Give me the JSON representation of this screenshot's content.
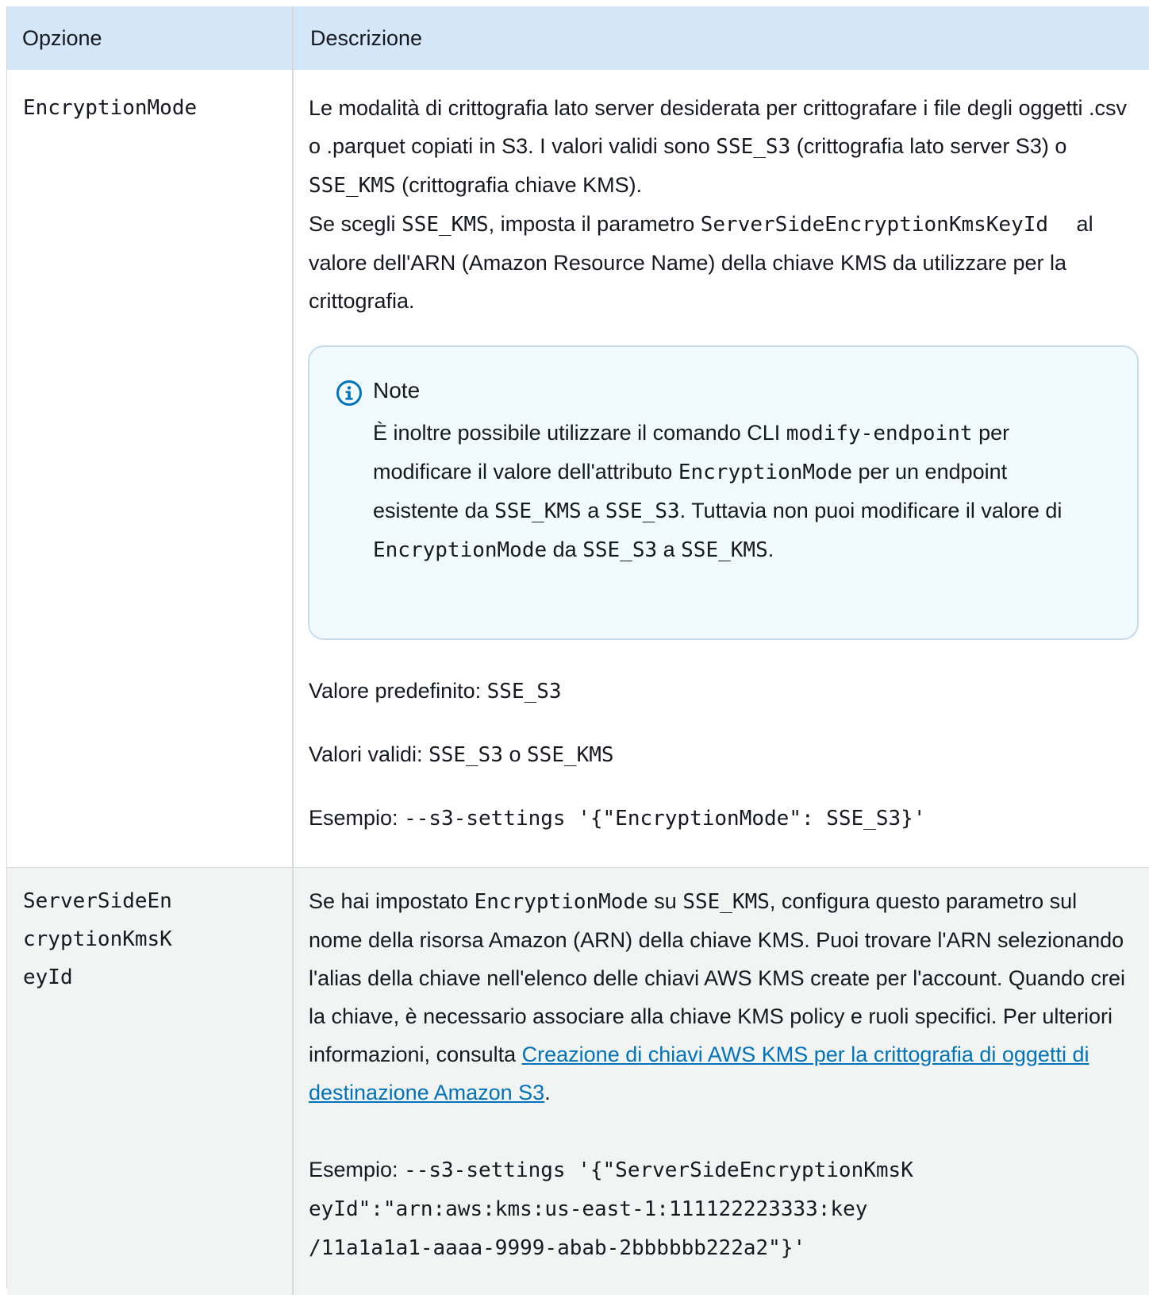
{
  "table": {
    "headers": {
      "option": "Opzione",
      "description": "Descrizione"
    },
    "rows": [
      {
        "option": "EncryptionMode",
        "desc": {
          "t1": "Le modalità di crittografia lato server desiderata per crittografare i file degli oggetti .csv o .parquet copiati in S3. I valori validi sono ",
          "c1": "SSE_S3",
          "t2": " (crittografia lato server S3) o ",
          "c2": "SSE_KMS",
          "t3": " (crittografia chiave KMS).",
          "t4": "Se scegli ",
          "c3": "SSE_KMS",
          "t5": ", imposta il parametro ",
          "c4": "ServerSideEncryptionKmsKeyId",
          "t6": " al valore dell'ARN (Amazon Resource Name) della chiave KMS da utilizzare per la crittografia."
        },
        "note": {
          "title": "Note",
          "icon": "info-icon",
          "t1": "È inoltre possibile utilizzare il comando CLI ",
          "c1": "modify-endpoint",
          "t2": " per modificare il valore dell'attributo ",
          "c2": "EncryptionMode",
          "t3": " per un endpoint esistente da ",
          "c3": "SSE_KMS",
          "t4": " a ",
          "c4": "SSE_S3",
          "t5": ". Tuttavia non puoi modificare il valore di ",
          "c5": "EncryptionMode",
          "t6": " da ",
          "c6": "SSE_S3",
          "t7": " a ",
          "c7": "SSE_KMS",
          "t8": "."
        },
        "default": {
          "label": "Valore predefinito: ",
          "value": "SSE_S3"
        },
        "valid": {
          "label": "Valori validi: ",
          "v1": "SSE_S3",
          "sep": " o ",
          "v2": "SSE_KMS"
        },
        "example": {
          "label": "Esempio: ",
          "code": "--s3-settings '{\"EncryptionMode\": SSE_S3}'"
        }
      },
      {
        "option": "ServerSideEncryptionKmsKeyId",
        "desc": {
          "t1": "Se hai impostato ",
          "c1": "EncryptionMode",
          "t2": " su ",
          "c2": "SSE_KMS",
          "t3": ", configura questo parametro sul nome della risorsa Amazon (ARN) della chiave KMS. Puoi trovare l'ARN selezionando l'alias della chiave nell'elenco delle chiavi AWS KMS create per l'account. Quando crei la chiave, è necessario associare alla chiave KMS policy e ruoli specifici. Per ulteriori informazioni, consulta ",
          "link": "Creazione di chiavi AWS KMS per la crittografia di oggetti di destinazione Amazon S3",
          "t4": "."
        },
        "example": {
          "label": "Esempio: ",
          "code1": "--s3-settings '{\"ServerSideEncryptionKmsK",
          "code2": "eyId\":\"arn:aws:kms:us-east-1:111122223333:key",
          "code3": "/11a1a1a1-aaaa-9999-abab-2bbbbbb222a2\"}'"
        }
      }
    ]
  },
  "colors": {
    "header_bg": "#d4e6f7",
    "row_alt_bg": "#f2f3f3",
    "note_bg": "#f1faff",
    "note_border": "#c7dcea",
    "link": "#0073bb",
    "info_icon": "#0073bb"
  }
}
